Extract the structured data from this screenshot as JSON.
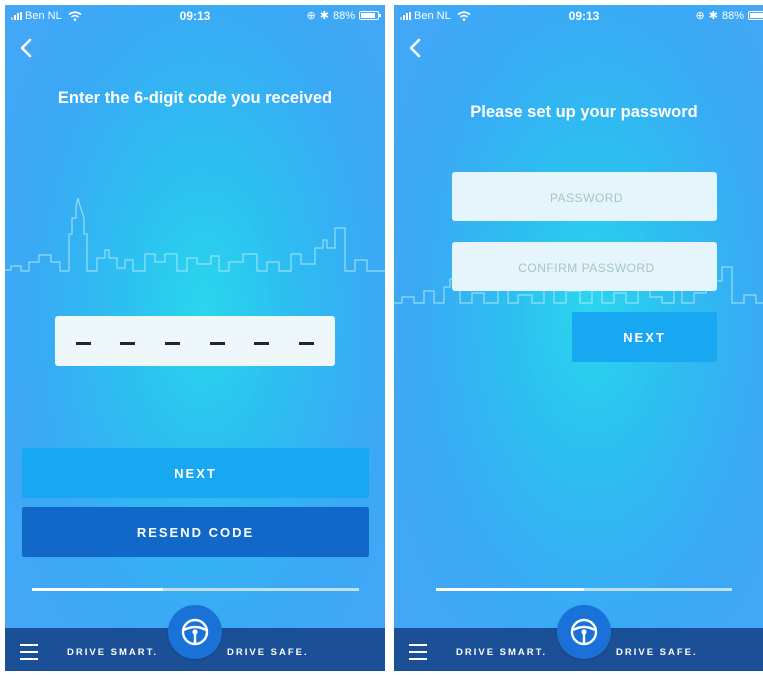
{
  "status_bar": {
    "carrier": "Ben NL",
    "time": "09:13",
    "battery": "88%",
    "battery_level": 0.88
  },
  "screen_code": {
    "title": "Enter the 6-digit code you received",
    "code_slots": [
      "-",
      "-",
      "-",
      "-",
      "-",
      "-"
    ],
    "next_label": "NEXT",
    "resend_label": "RESEND CODE",
    "progress": 0.4
  },
  "screen_password": {
    "title": "Please set up your password",
    "password_placeholder": "PASSWORD",
    "confirm_placeholder": "CONFIRM PASSWORD",
    "next_label": "NEXT",
    "progress": 0.5
  },
  "bottom_bar": {
    "tagline_left": "DRIVE SMART.",
    "tagline_right": "DRIVE SAFE."
  },
  "colors": {
    "background": "#47a6f6",
    "next_button": "#18a8f2",
    "resend_button": "#1268c9",
    "bottom_bar": "#1b4f96",
    "wheel_button": "#1a72d8"
  },
  "icons": {
    "back": "chevron-left-icon",
    "menu": "hamburger-menu-icon",
    "center": "steering-wheel-icon",
    "status": [
      "signal-icon",
      "wifi-icon",
      "location-icon",
      "bluetooth-icon",
      "battery-icon"
    ]
  }
}
